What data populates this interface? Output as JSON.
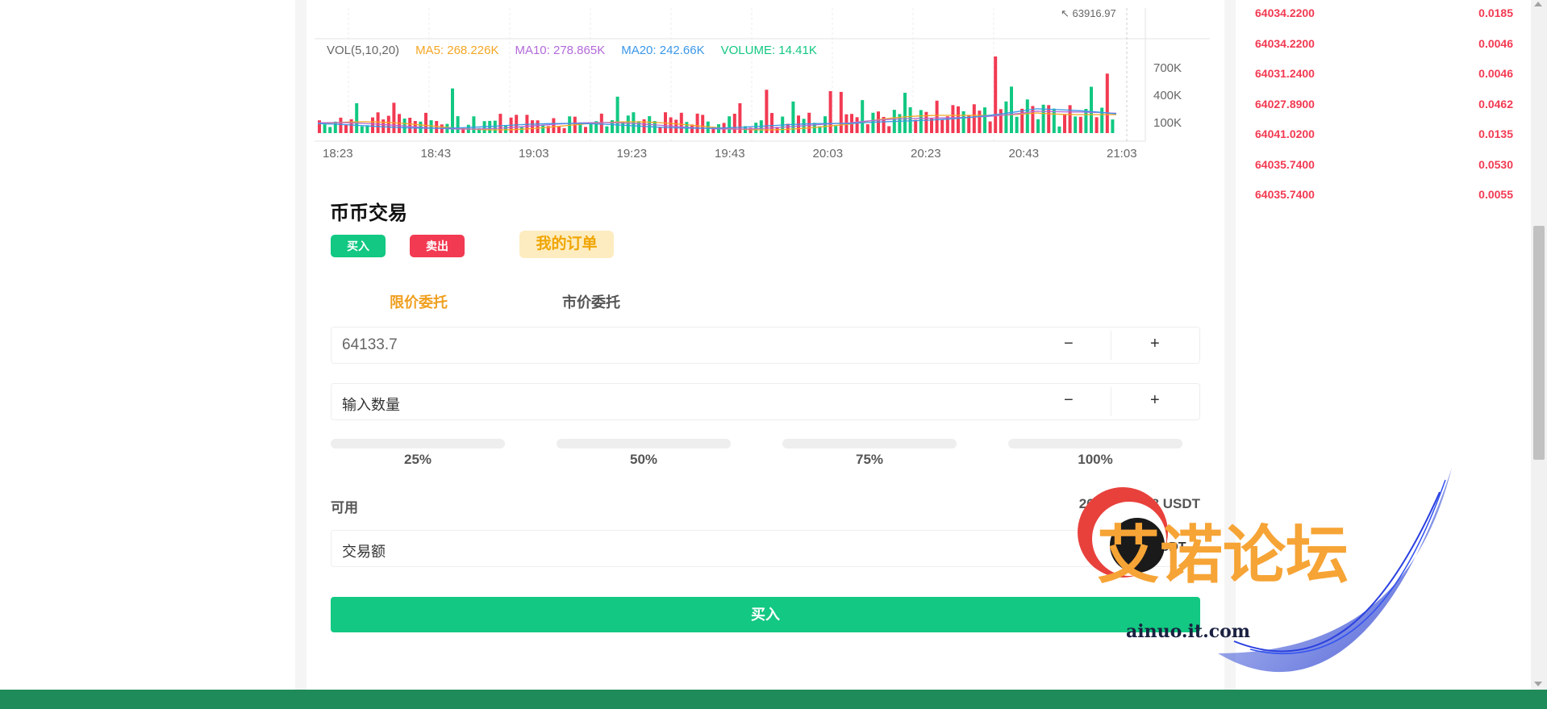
{
  "chart": {
    "legend": {
      "vol": "VOL(5,10,20)",
      "ma5": "MA5: 268.226K",
      "ma10": "MA10: 278.865K",
      "ma20": "MA20: 242.66K",
      "volume": "VOLUME: 14.41K"
    },
    "price_marker": "63916.97",
    "y_ticks": [
      "700K",
      "400K",
      "100K"
    ],
    "x_ticks": [
      "18:23",
      "18:43",
      "19:03",
      "19:23",
      "19:43",
      "20:03",
      "20:23",
      "20:43",
      "21:03"
    ],
    "colors": {
      "ma5": "#f5a623",
      "ma10": "#b36ad8",
      "ma20": "#3a97e8",
      "volume": "#12c882",
      "up": "#12c882",
      "down": "#f23a52"
    }
  },
  "orderbook": [
    {
      "price": "64034.2200",
      "qty": "0.0185"
    },
    {
      "price": "64034.2200",
      "qty": "0.0046"
    },
    {
      "price": "64031.2400",
      "qty": "0.0046"
    },
    {
      "price": "64027.8900",
      "qty": "0.0462"
    },
    {
      "price": "64041.0200",
      "qty": "0.0135"
    },
    {
      "price": "64035.7400",
      "qty": "0.0530"
    },
    {
      "price": "64035.7400",
      "qty": "0.0055"
    }
  ],
  "trade": {
    "title": "币币交易",
    "buy_tab": "买入",
    "sell_tab": "卖出",
    "my_orders": "我的订单",
    "limit_tab": "限价委托",
    "market_tab": "市价委托",
    "price_value": "64133.7",
    "qty_placeholder": "输入数量",
    "minus": "−",
    "plus": "+",
    "percents": [
      "25%",
      "50%",
      "75%",
      "100%"
    ],
    "available_label": "可用",
    "available_value": "269239.7778 USDT",
    "amount_placeholder": "交易额",
    "amount_unit": "USDT",
    "submit": "买入"
  },
  "watermark": {
    "text": "艾诺论坛",
    "site": "ainuo.it.com"
  }
}
